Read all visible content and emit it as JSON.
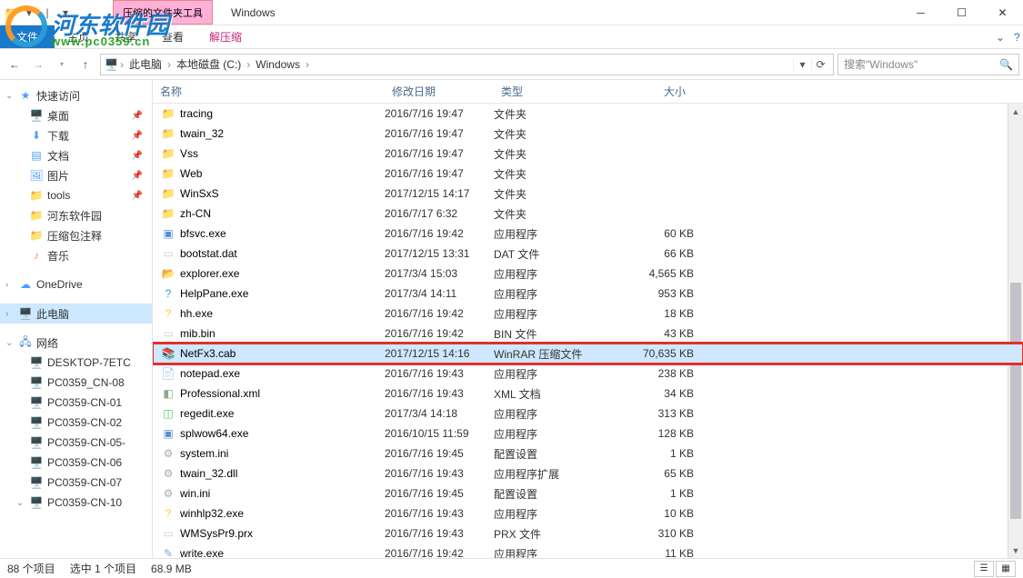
{
  "window": {
    "context_tab_group": "压缩的文件夹工具",
    "title": "Windows"
  },
  "ribbon": {
    "file": "文件",
    "tabs": [
      "主页",
      "共享",
      "查看",
      "解压缩"
    ]
  },
  "breadcrumb": {
    "items": [
      "此电脑",
      "本地磁盘 (C:)",
      "Windows"
    ]
  },
  "search": {
    "placeholder": "搜索\"Windows\""
  },
  "nav": {
    "quick": {
      "label": "快速访问",
      "items": [
        {
          "label": "桌面",
          "pin": true,
          "icon": "desktop"
        },
        {
          "label": "下载",
          "pin": true,
          "icon": "download"
        },
        {
          "label": "文档",
          "pin": true,
          "icon": "doc"
        },
        {
          "label": "图片",
          "pin": true,
          "icon": "picture"
        },
        {
          "label": "tools",
          "pin": true,
          "icon": "folder"
        },
        {
          "label": "河东软件园",
          "pin": false,
          "icon": "folder"
        },
        {
          "label": "压缩包注释",
          "pin": false,
          "icon": "folder"
        },
        {
          "label": "音乐",
          "pin": false,
          "icon": "music"
        }
      ]
    },
    "onedrive": "OneDrive",
    "thispc": "此电脑",
    "network": {
      "label": "网络",
      "items": [
        "DESKTOP-7ETC",
        "PC0359_CN-08",
        "PC0359-CN-01",
        "PC0359-CN-02",
        "PC0359-CN-05-",
        "PC0359-CN-06",
        "PC0359-CN-07",
        "PC0359-CN-10"
      ]
    }
  },
  "columns": {
    "name": "名称",
    "date": "修改日期",
    "type": "类型",
    "size": "大小"
  },
  "files": [
    {
      "name": "tracing",
      "date": "2016/7/16 19:47",
      "type": "文件夹",
      "size": "",
      "icon": "folder",
      "partial": true
    },
    {
      "name": "twain_32",
      "date": "2016/7/16 19:47",
      "type": "文件夹",
      "size": "",
      "icon": "folder"
    },
    {
      "name": "Vss",
      "date": "2016/7/16 19:47",
      "type": "文件夹",
      "size": "",
      "icon": "folder"
    },
    {
      "name": "Web",
      "date": "2016/7/16 19:47",
      "type": "文件夹",
      "size": "",
      "icon": "folder"
    },
    {
      "name": "WinSxS",
      "date": "2017/12/15 14:17",
      "type": "文件夹",
      "size": "",
      "icon": "folder"
    },
    {
      "name": "zh-CN",
      "date": "2016/7/17 6:32",
      "type": "文件夹",
      "size": "",
      "icon": "folder"
    },
    {
      "name": "bfsvc.exe",
      "date": "2016/7/16 19:42",
      "type": "应用程序",
      "size": "60 KB",
      "icon": "exe"
    },
    {
      "name": "bootstat.dat",
      "date": "2017/12/15 13:31",
      "type": "DAT 文件",
      "size": "66 KB",
      "icon": "file"
    },
    {
      "name": "explorer.exe",
      "date": "2017/3/4 15:03",
      "type": "应用程序",
      "size": "4,565 KB",
      "icon": "explorer"
    },
    {
      "name": "HelpPane.exe",
      "date": "2017/3/4 14:11",
      "type": "应用程序",
      "size": "953 KB",
      "icon": "help"
    },
    {
      "name": "hh.exe",
      "date": "2016/7/16 19:42",
      "type": "应用程序",
      "size": "18 KB",
      "icon": "hh"
    },
    {
      "name": "mib.bin",
      "date": "2016/7/16 19:42",
      "type": "BIN 文件",
      "size": "43 KB",
      "icon": "file"
    },
    {
      "name": "NetFx3.cab",
      "date": "2017/12/15 14:16",
      "type": "WinRAR 压缩文件",
      "size": "70,635 KB",
      "icon": "rar",
      "selected": true,
      "highlighted": true
    },
    {
      "name": "notepad.exe",
      "date": "2016/7/16 19:43",
      "type": "应用程序",
      "size": "238 KB",
      "icon": "notepad"
    },
    {
      "name": "Professional.xml",
      "date": "2016/7/16 19:43",
      "type": "XML 文档",
      "size": "34 KB",
      "icon": "xml"
    },
    {
      "name": "regedit.exe",
      "date": "2017/3/4 14:18",
      "type": "应用程序",
      "size": "313 KB",
      "icon": "regedit"
    },
    {
      "name": "splwow64.exe",
      "date": "2016/10/15 11:59",
      "type": "应用程序",
      "size": "128 KB",
      "icon": "exe"
    },
    {
      "name": "system.ini",
      "date": "2016/7/16 19:45",
      "type": "配置设置",
      "size": "1 KB",
      "icon": "ini"
    },
    {
      "name": "twain_32.dll",
      "date": "2016/7/16 19:43",
      "type": "应用程序扩展",
      "size": "65 KB",
      "icon": "dll"
    },
    {
      "name": "win.ini",
      "date": "2016/7/16 19:45",
      "type": "配置设置",
      "size": "1 KB",
      "icon": "ini"
    },
    {
      "name": "winhlp32.exe",
      "date": "2016/7/16 19:43",
      "type": "应用程序",
      "size": "10 KB",
      "icon": "hh"
    },
    {
      "name": "WMSysPr9.prx",
      "date": "2016/7/16 19:43",
      "type": "PRX 文件",
      "size": "310 KB",
      "icon": "file"
    },
    {
      "name": "write.exe",
      "date": "2016/7/16 19:42",
      "type": "应用程序",
      "size": "11 KB",
      "icon": "write"
    }
  ],
  "status": {
    "count": "88 个项目",
    "selection": "选中 1 个项目",
    "size": "68.9 MB"
  },
  "watermark": {
    "line1": "河东软件园",
    "line2": "www.pc0359.cn"
  }
}
